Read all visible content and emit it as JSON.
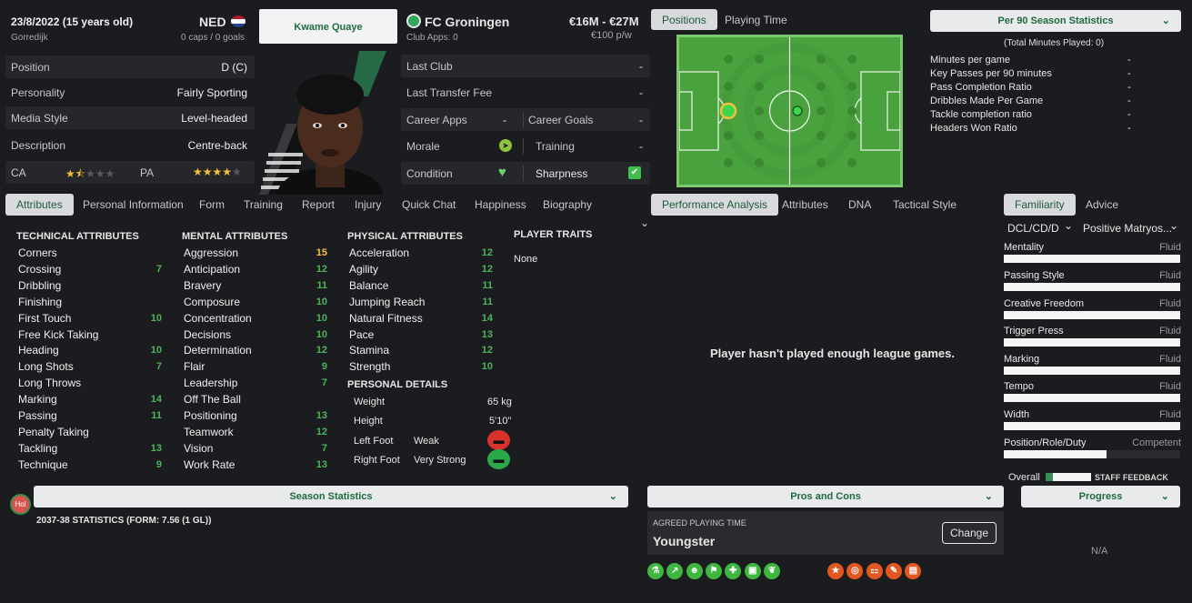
{
  "player": {
    "dob": "23/8/2022 (15 years old)",
    "birthplace": "Gorredijk",
    "nation": "NED",
    "caps": "0 caps / 0 goals",
    "name": "Kwame Quaye",
    "club": "FC Groningen",
    "club_apps": "Club Apps: 0",
    "value": "€16M - €27M",
    "wage": "€100 p/w"
  },
  "info_rows": [
    {
      "label": "Position",
      "value": "D (C)"
    },
    {
      "label": "Personality",
      "value": "Fairly Sporting"
    },
    {
      "label": "Media Style",
      "value": "Level-headed"
    },
    {
      "label": "Description",
      "value": "Centre-back"
    }
  ],
  "ability": {
    "ca_label": "CA",
    "pa_label": "PA",
    "ca_stars": 1.5,
    "pa_stars": 4
  },
  "career": {
    "last_club_label": "Last Club",
    "last_club": "-",
    "last_fee_label": "Last Transfer Fee",
    "last_fee": "-",
    "apps_label": "Career Apps",
    "apps": "-",
    "goals_label": "Career Goals",
    "goals": "-",
    "morale_label": "Morale",
    "training_label": "Training",
    "training": "-",
    "condition_label": "Condition",
    "sharpness_label": "Sharpness"
  },
  "top_tabs": {
    "positions": "Positions",
    "playing_time": "Playing Time"
  },
  "stats_select": "Per 90 Season Statistics",
  "stats_total": "(Total Minutes Played: 0)",
  "stats": [
    {
      "label": "Minutes per game",
      "value": "-"
    },
    {
      "label": "Key Passes per 90 minutes",
      "value": "-"
    },
    {
      "label": "Pass Completion Ratio",
      "value": "-"
    },
    {
      "label": "Dribbles Made Per Game",
      "value": "-"
    },
    {
      "label": "Tackle completion ratio",
      "value": "-"
    },
    {
      "label": "Headers Won Ratio",
      "value": "-"
    }
  ],
  "tabs": [
    "Attributes",
    "Personal Information",
    "Form",
    "Training",
    "Report",
    "Injury",
    "Quick Chat",
    "Happiness",
    "Biography"
  ],
  "mid_tabs": [
    "Performance Analysis",
    "Attributes",
    "DNA",
    "Tactical Style"
  ],
  "right_tabs": [
    "Familiarity",
    "Advice"
  ],
  "technical": {
    "title": "TECHNICAL ATTRIBUTES",
    "items": [
      {
        "name": "Corners",
        "value": ""
      },
      {
        "name": "Crossing",
        "value": "7"
      },
      {
        "name": "Dribbling",
        "value": ""
      },
      {
        "name": "Finishing",
        "value": ""
      },
      {
        "name": "First Touch",
        "value": "10"
      },
      {
        "name": "Free Kick Taking",
        "value": ""
      },
      {
        "name": "Heading",
        "value": "10"
      },
      {
        "name": "Long Shots",
        "value": "7"
      },
      {
        "name": "Long Throws",
        "value": ""
      },
      {
        "name": "Marking",
        "value": "14"
      },
      {
        "name": "Passing",
        "value": "11"
      },
      {
        "name": "Penalty Taking",
        "value": ""
      },
      {
        "name": "Tackling",
        "value": "13"
      },
      {
        "name": "Technique",
        "value": "9"
      }
    ]
  },
  "mental": {
    "title": "MENTAL ATTRIBUTES",
    "items": [
      {
        "name": "Aggression",
        "value": "15"
      },
      {
        "name": "Anticipation",
        "value": "12"
      },
      {
        "name": "Bravery",
        "value": "11"
      },
      {
        "name": "Composure",
        "value": "10"
      },
      {
        "name": "Concentration",
        "value": "10"
      },
      {
        "name": "Decisions",
        "value": "10"
      },
      {
        "name": "Determination",
        "value": "12"
      },
      {
        "name": "Flair",
        "value": "9"
      },
      {
        "name": "Leadership",
        "value": "7"
      },
      {
        "name": "Off The Ball",
        "value": ""
      },
      {
        "name": "Positioning",
        "value": "13"
      },
      {
        "name": "Teamwork",
        "value": "12"
      },
      {
        "name": "Vision",
        "value": "7"
      },
      {
        "name": "Work Rate",
        "value": "13"
      }
    ]
  },
  "physical": {
    "title": "PHYSICAL ATTRIBUTES",
    "items": [
      {
        "name": "Acceleration",
        "value": "12"
      },
      {
        "name": "Agility",
        "value": "12"
      },
      {
        "name": "Balance",
        "value": "11"
      },
      {
        "name": "Jumping Reach",
        "value": "11"
      },
      {
        "name": "Natural Fitness",
        "value": "14"
      },
      {
        "name": "Pace",
        "value": "13"
      },
      {
        "name": "Stamina",
        "value": "12"
      },
      {
        "name": "Strength",
        "value": "10"
      }
    ]
  },
  "traits": {
    "title": "PLAYER TRAITS",
    "value": "None"
  },
  "personal": {
    "title": "PERSONAL DETAILS",
    "weight_label": "Weight",
    "weight": "65 kg",
    "height_label": "Height",
    "height": "5'10\"",
    "left_foot_label": "Left Foot",
    "left_foot": "Weak",
    "right_foot_label": "Right Foot",
    "right_foot": "Very Strong"
  },
  "not_enough": "Player hasn't played enough league games.",
  "familiarity": {
    "position_select": "DCL/CD/D",
    "role_select": "Positive Matryos...",
    "items": [
      {
        "label": "Mentality",
        "status": "Fluid"
      },
      {
        "label": "Passing Style",
        "status": "Fluid"
      },
      {
        "label": "Creative Freedom",
        "status": "Fluid"
      },
      {
        "label": "Trigger Press",
        "status": "Fluid"
      },
      {
        "label": "Marking",
        "status": "Fluid"
      },
      {
        "label": "Tempo",
        "status": "Fluid"
      },
      {
        "label": "Width",
        "status": "Fluid"
      },
      {
        "label": "Position/Role/Duty",
        "status": "Competent",
        "fill": 0.58
      }
    ],
    "overall_label": "Overall",
    "staff_feedback": "STAFF FEEDBACK"
  },
  "bottom": {
    "hol": "Hol",
    "season_stats": "Season Statistics",
    "season_line": "2037-38 STATISTICS (FORM: 7.56 (1 GL))",
    "pros_cons": "Pros and Cons",
    "progress": "Progress",
    "agreed_label": "AGREED PLAYING TIME",
    "agreed_value": "Youngster",
    "change": "Change",
    "na": "N/A"
  },
  "colors": {
    "accent_green": "#4fb35a",
    "highlight_yellow": "#f3c03a",
    "pitch": "#4aa23f",
    "button_text": "#1f6a3e"
  }
}
